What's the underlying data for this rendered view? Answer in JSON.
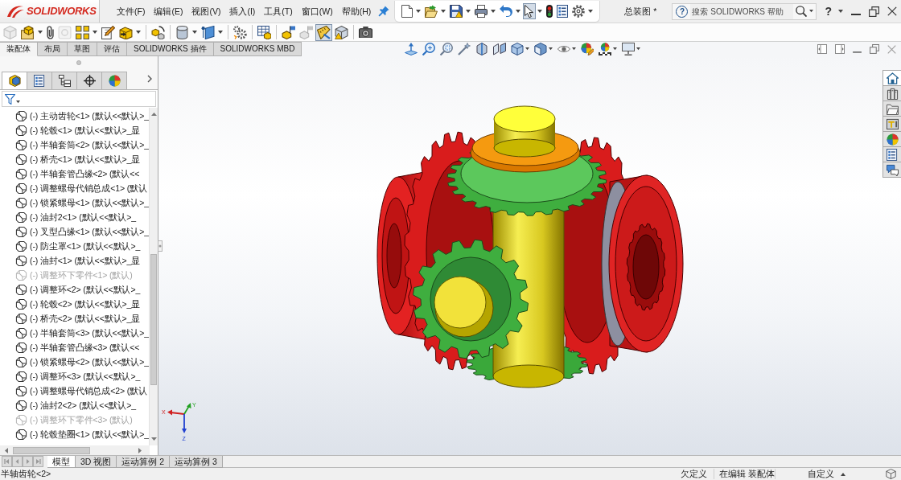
{
  "app_bar": {
    "logo": "SOLIDWORKS",
    "menu": [
      "文件(F)",
      "编辑(E)",
      "视图(V)",
      "插入(I)",
      "工具(T)",
      "窗口(W)",
      "帮助(H)"
    ]
  },
  "quick_toolbar": [
    {
      "on": false
    },
    {
      "on": false
    },
    {
      "on": false
    },
    {
      "on": false
    },
    {
      "on": false
    },
    {
      "on": true
    },
    {
      "on": false
    },
    {
      "on": false
    },
    {
      "on": false
    }
  ],
  "document_title": "总装图 *",
  "search": {
    "help_mark": "?",
    "placeholder": "搜索 SOLIDWORKS 帮助"
  },
  "help_button": "?",
  "command_toolbar": [
    {
      "disabled": true,
      "on": false
    },
    {
      "disabled": false,
      "on": false
    },
    {
      "disabled": false,
      "on": false
    },
    {
      "disabled": true,
      "on": false
    },
    {
      "disabled": false,
      "on": false
    },
    {
      "disabled": false,
      "on": false
    },
    {
      "disabled": false,
      "on": false
    },
    {
      "disabled": false,
      "on": false
    },
    {
      "disabled": false,
      "on": false
    },
    {
      "disabled": false,
      "on": false
    },
    {
      "disabled": false,
      "on": false
    },
    {
      "disabled": false,
      "on": false
    },
    {
      "disabled": false,
      "on": false
    },
    {
      "disabled": true,
      "on": false
    },
    {
      "disabled": false,
      "on": true
    },
    {
      "disabled": false,
      "on": false
    },
    {
      "disabled": false,
      "on": false
    }
  ],
  "command_tabs": [
    {
      "label": "装配体",
      "selected": true
    },
    {
      "label": "布局",
      "selected": false
    },
    {
      "label": "草图",
      "selected": false
    },
    {
      "label": "评估",
      "selected": false
    },
    {
      "label": "SOLIDWORKS 插件",
      "selected": false
    },
    {
      "label": "SOLIDWORKS MBD",
      "selected": false
    }
  ],
  "panel_tabs": [
    {
      "selected": true
    },
    {
      "selected": false
    },
    {
      "selected": false
    },
    {
      "selected": false
    },
    {
      "selected": false
    }
  ],
  "tree": [
    {
      "label": "(-) 主动齿轮<1> (默认<<默认>_",
      "suppressed": false
    },
    {
      "label": "(-) 轮毂<1> (默认<<默认>_显",
      "suppressed": false
    },
    {
      "label": "(-) 半轴套筒<2> (默认<<默认>_",
      "suppressed": false
    },
    {
      "label": "(-) 桥壳<1> (默认<<默认>_显",
      "suppressed": false
    },
    {
      "label": "(-) 半轴套管凸缘<2> (默认<<",
      "suppressed": false
    },
    {
      "label": "(-) 调整螺母代销总成<1> (默认",
      "suppressed": false
    },
    {
      "label": "(-) 锁紧螺母<1> (默认<<默认>_",
      "suppressed": false
    },
    {
      "label": "(-) 油封2<1> (默认<<默认>_",
      "suppressed": false
    },
    {
      "label": "(-) 叉型凸缘<1> (默认<<默认>_",
      "suppressed": false
    },
    {
      "label": "(-) 防尘罩<1> (默认<<默认>_",
      "suppressed": false
    },
    {
      "label": "(-) 油封<1> (默认<<默认>_显",
      "suppressed": false
    },
    {
      "label": "(-) 调整环下零件<1> (默认)",
      "suppressed": true
    },
    {
      "label": "(-) 调整环<2> (默认<<默认>_",
      "suppressed": false
    },
    {
      "label": "(-) 轮毂<2> (默认<<默认>_显",
      "suppressed": false
    },
    {
      "label": "(-) 桥壳<2> (默认<<默认>_显",
      "suppressed": false
    },
    {
      "label": "(-) 半轴套筒<3> (默认<<默认>_",
      "suppressed": false
    },
    {
      "label": "(-) 半轴套管凸缘<3> (默认<<",
      "suppressed": false
    },
    {
      "label": "(-) 锁紧螺母<2> (默认<<默认>_",
      "suppressed": false
    },
    {
      "label": "(-) 调整环<3> (默认<<默认>_",
      "suppressed": false
    },
    {
      "label": "(-) 调整螺母代销总成<2> (默认",
      "suppressed": false
    },
    {
      "label": "(-) 油封2<2> (默认<<默认>_",
      "suppressed": false
    },
    {
      "label": "(-) 调整环下零件<3> (默认)",
      "suppressed": true
    },
    {
      "label": "(-) 轮毂垫圈<1> (默认<<默认>_",
      "suppressed": false
    }
  ],
  "triad": {
    "x": "X",
    "y": "Y",
    "z": "Z"
  },
  "task_pane": [
    {
      "selected": true
    },
    {
      "selected": false
    },
    {
      "selected": false
    },
    {
      "selected": false
    },
    {
      "selected": false
    },
    {
      "selected": false
    },
    {
      "selected": false
    }
  ],
  "model_tabs": [
    {
      "label": "模型",
      "selected": true
    },
    {
      "label": "3D 视图",
      "selected": false
    },
    {
      "label": "运动算例 2",
      "selected": false
    },
    {
      "label": "运动算例 3",
      "selected": false
    }
  ],
  "status_bar": {
    "message": "半轴齿轮<2>",
    "fields": [
      "欠定义",
      "在编辑 装配体",
      "自定义"
    ]
  }
}
